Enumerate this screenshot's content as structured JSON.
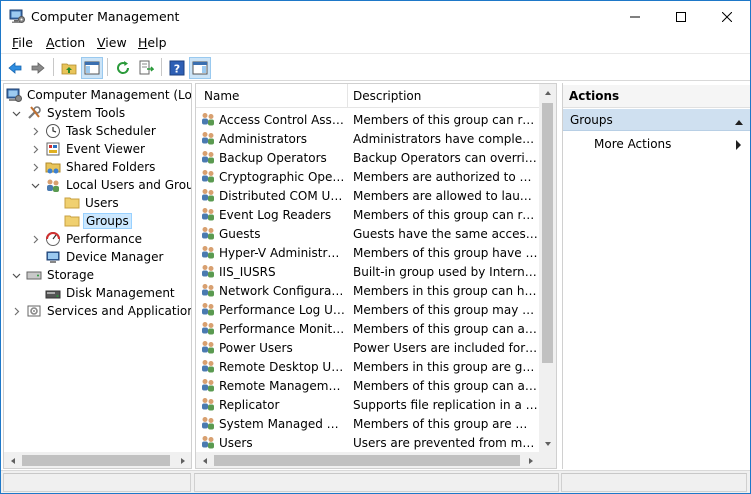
{
  "window": {
    "title": "Computer Management",
    "minimize_glyph": "—",
    "maximize_glyph": "☐",
    "close_glyph": "✕"
  },
  "menu": {
    "file": "ile",
    "file_ul": "F",
    "action": "ction",
    "action_ul": "A",
    "view": "iew",
    "view_ul": "V",
    "help": "elp",
    "help_ul": "H"
  },
  "toolbar": {
    "icons": [
      "back-arrow-icon",
      "forward-arrow-icon",
      "up-folder-icon",
      "show-hide-console-tree-icon",
      "refresh-icon",
      "export-list-icon",
      "help-icon",
      "show-hide-action-pane-icon"
    ]
  },
  "tree": {
    "root": "Computer Management (Local)",
    "system_tools": "System Tools",
    "task_scheduler": "Task Scheduler",
    "event_viewer": "Event Viewer",
    "shared_folders": "Shared Folders",
    "local_users_groups": "Local Users and Groups",
    "users": "Users",
    "groups": "Groups",
    "performance": "Performance",
    "device_manager": "Device Manager",
    "storage": "Storage",
    "disk_management": "Disk Management",
    "services_apps": "Services and Applications"
  },
  "list": {
    "columns": {
      "name": "Name",
      "description": "Description"
    },
    "rows": [
      {
        "name": "Access Control Assist...",
        "description": "Members of this group can remot..."
      },
      {
        "name": "Administrators",
        "description": "Administrators have complete an..."
      },
      {
        "name": "Backup Operators",
        "description": "Backup Operators can override se..."
      },
      {
        "name": "Cryptographic Operat...",
        "description": "Members are authorized to perfor..."
      },
      {
        "name": "Distributed COM Users",
        "description": "Members are allowed to launch, a..."
      },
      {
        "name": "Event Log Readers",
        "description": "Members of this group can read e..."
      },
      {
        "name": "Guests",
        "description": "Guests have the same access as m..."
      },
      {
        "name": "Hyper-V Administrators",
        "description": "Members of this group have com..."
      },
      {
        "name": "IIS_IUSRS",
        "description": "Built-in group used by Internet Inf..."
      },
      {
        "name": "Network Configuratio...",
        "description": "Members in this group can have s..."
      },
      {
        "name": "Performance Log Users",
        "description": "Members of this group may sche..."
      },
      {
        "name": "Performance Monitor ...",
        "description": "Members of this group can acces..."
      },
      {
        "name": "Power Users",
        "description": "Power Users are included for back..."
      },
      {
        "name": "Remote Desktop Users",
        "description": "Members in this group are grante..."
      },
      {
        "name": "Remote Management...",
        "description": "Members of this group can acces..."
      },
      {
        "name": "Replicator",
        "description": "Supports file replication in a dom..."
      },
      {
        "name": "System Managed Acc...",
        "description": "Members of this group are mana..."
      },
      {
        "name": "Users",
        "description": "Users are prevented from making ..."
      }
    ]
  },
  "actions": {
    "header": "Actions",
    "group": "Groups",
    "more_actions": "More Actions"
  },
  "colors": {
    "accent": "#1e78c8",
    "selection": "#cce8ff",
    "actions_group_bg": "#cfe0f0"
  }
}
